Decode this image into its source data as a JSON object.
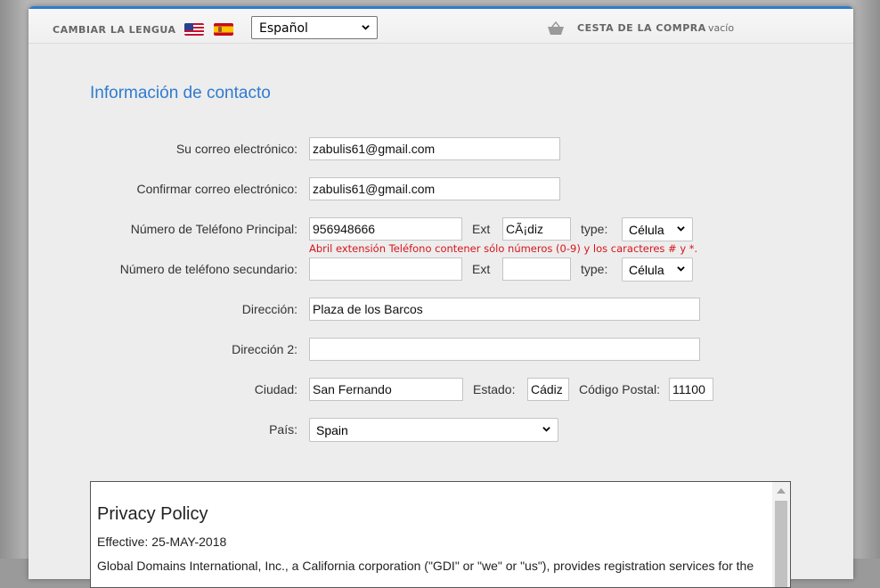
{
  "header": {
    "language_label": "CAMBIAR LA LENGUA",
    "language_select": "Español",
    "cart_label": "CESTA DE LA COMPRA",
    "cart_status": "vacío",
    "flags": [
      "us-flag-icon",
      "spain-flag-icon"
    ]
  },
  "form": {
    "title": "Información de contacto",
    "email_label": "Su correo electrónico:",
    "email_value": "zabulis61@gmail.com",
    "confirm_email_label": "Confirmar correo electrónico:",
    "confirm_email_value": "zabulis61@gmail.com",
    "primary_phone_label": "Número de Teléfono Principal:",
    "primary_phone_value": "956948666",
    "primary_ext_label": "Ext",
    "primary_ext_value": "CÃ¡diz",
    "primary_type_label": "type:",
    "primary_type_value": "Célula",
    "phone_error": "Abril extensión Teléfono contener sólo números (0-9) y los caracteres # y *.",
    "secondary_phone_label": "Número de teléfono secundario:",
    "secondary_phone_value": "",
    "secondary_ext_label": "Ext",
    "secondary_ext_value": "",
    "secondary_type_label": "type:",
    "secondary_type_value": "Célula",
    "address_label": "Dirección:",
    "address_value": "Plaza de los Barcos",
    "address2_label": "Dirección 2:",
    "address2_value": "",
    "city_label": "Ciudad:",
    "city_value": "San Fernando",
    "state_label": "Estado:",
    "state_value": "Cádiz",
    "zip_label": "Código Postal:",
    "zip_value": "11100",
    "country_label": "País:",
    "country_value": "Spain"
  },
  "privacy": {
    "title": "Privacy Policy",
    "effective": "Effective: 25-MAY-2018",
    "body": "Global Domains International, Inc., a California corporation (\"GDI\" or \"we\" or \"us\"), provides registration services for the"
  },
  "colors": {
    "accent": "#2f7bd0",
    "error": "#d8141b"
  }
}
